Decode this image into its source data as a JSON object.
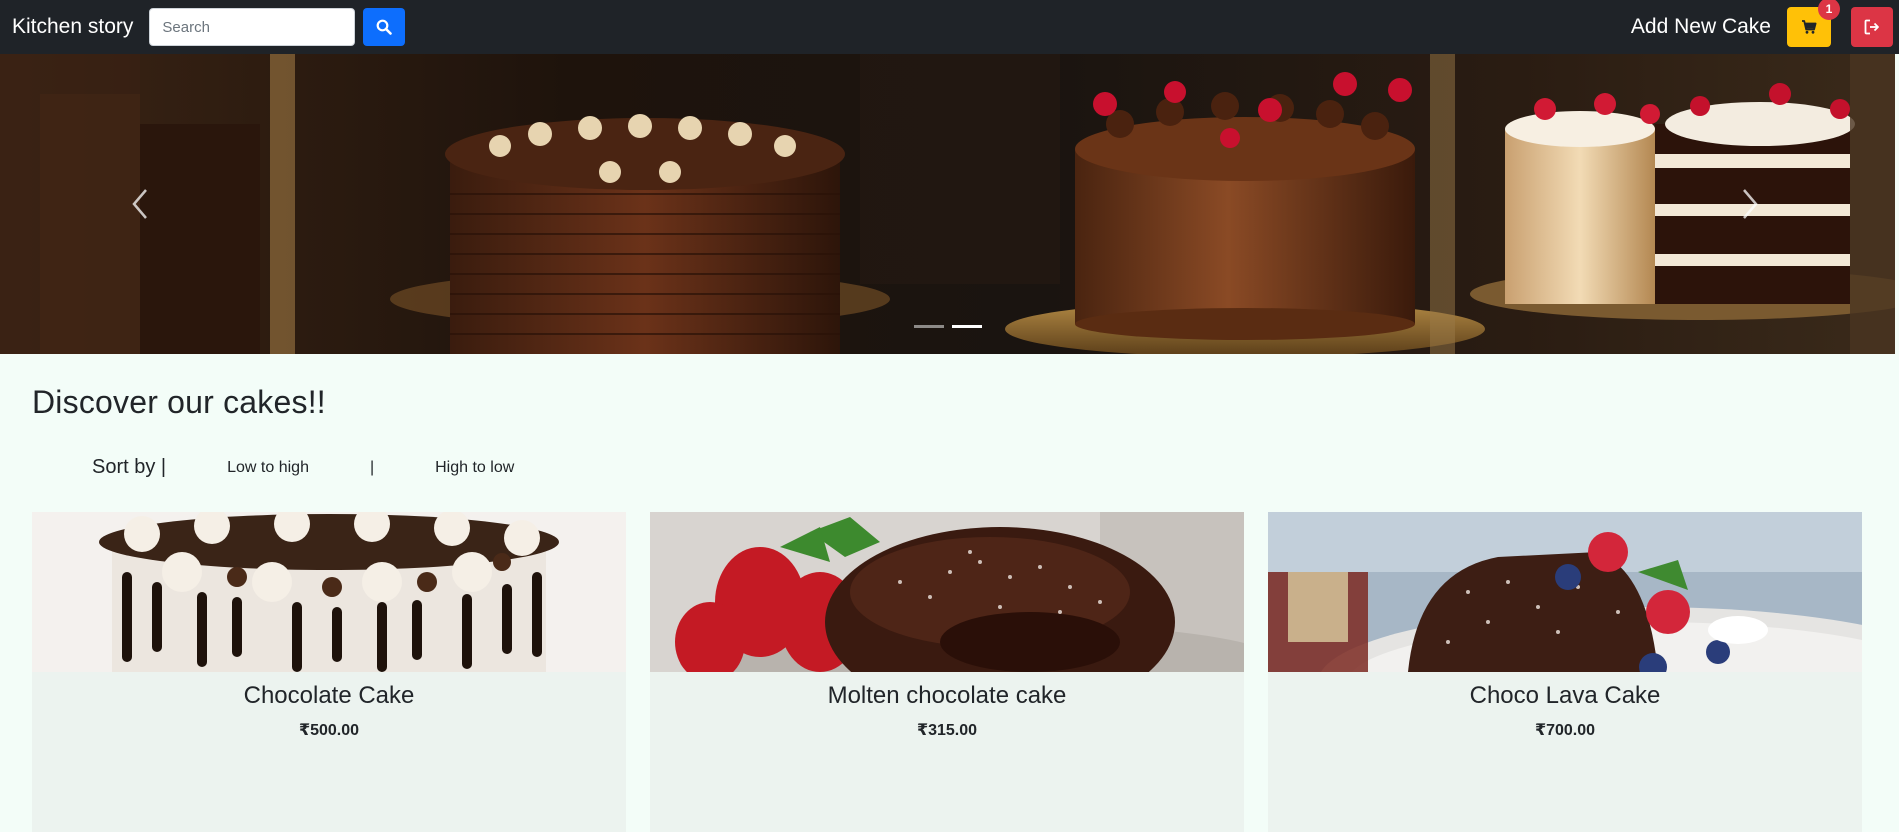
{
  "navbar": {
    "brand": "Kitchen story",
    "search_placeholder": "Search",
    "add_new_cake": "Add New Cake",
    "cart_count": "1",
    "icons": {
      "search": "search-icon",
      "cart": "cart-icon",
      "logout": "logout-icon"
    },
    "colors": {
      "background": "#1f2328",
      "search_button": "#0d6efd",
      "cart_button": "#ffc107",
      "logout_button": "#dc3545"
    }
  },
  "carousel": {
    "slide_count": 2,
    "active_slide": 2,
    "prev_icon": "chevron-left-icon",
    "next_icon": "chevron-right-icon"
  },
  "main": {
    "title": "Discover our cakes!!",
    "sort": {
      "label": "Sort by |",
      "low_to_high": "Low to high",
      "separator": "|",
      "high_to_low": "High to low"
    }
  },
  "products": [
    {
      "name": "Chocolate Cake",
      "price": "₹500.00"
    },
    {
      "name": "Molten chocolate cake",
      "price": "₹315.00"
    },
    {
      "name": "Choco Lava Cake",
      "price": "₹700.00"
    }
  ],
  "colors": {
    "page_background": "#f3fdf8",
    "card_background": "#ecf3ef"
  }
}
